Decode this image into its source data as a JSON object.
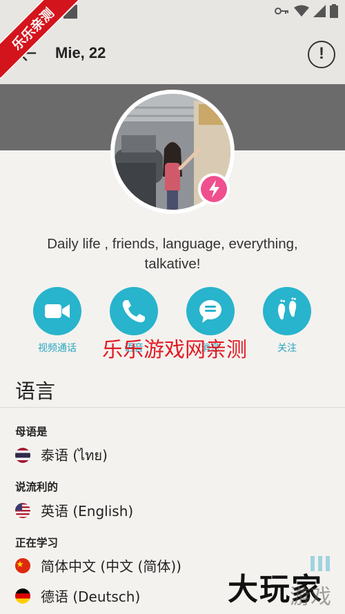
{
  "ribbon": {
    "text": "乐乐亲测"
  },
  "header": {
    "title": "Mie, 22"
  },
  "profile": {
    "bio": "Daily life , friends, language, everything, talkative!"
  },
  "actions": [
    {
      "label": "视频通话",
      "icon": "video-camera-icon"
    },
    {
      "label": "语音",
      "icon": "phone-icon"
    },
    {
      "label": "消息",
      "icon": "chat-bubble-icon"
    },
    {
      "label": "关注",
      "icon": "footprints-icon"
    }
  ],
  "watermark": {
    "center": "乐乐游戏网亲测",
    "corner": "大玩家",
    "corner_sub": "游戏"
  },
  "languages": {
    "section_title": "语言",
    "native_heading": "母语是",
    "native": [
      {
        "name": "泰语 (ไทย)",
        "flag": "thailand"
      }
    ],
    "fluent_heading": "说流利的",
    "fluent": [
      {
        "name": "英语 (English)",
        "flag": "usa"
      }
    ],
    "learning_heading": "正在学习",
    "learning": [
      {
        "name": "简体中文 (中文 (简体))",
        "flag": "china"
      },
      {
        "name": "德语 (Deutsch)",
        "flag": "germany"
      }
    ]
  },
  "colors": {
    "accent": "#28b4cc",
    "boost": "#ef4f8e",
    "cover": "#6b6b6b",
    "watermark_red": "#e21b23"
  }
}
